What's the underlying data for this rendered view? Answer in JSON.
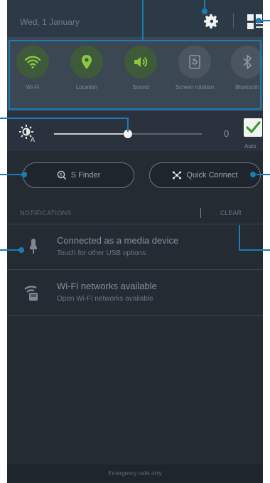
{
  "status": {
    "date": "Wed, 1 January"
  },
  "header_icons": [
    "gear-icon",
    "quick-panel-grid-icon"
  ],
  "quick_settings": [
    {
      "label": "Wi-Fi",
      "icon": "wifi-icon",
      "on": true
    },
    {
      "label": "Location",
      "icon": "location-icon",
      "on": true
    },
    {
      "label": "Sound",
      "icon": "sound-icon",
      "on": true
    },
    {
      "label": "Screen rotation",
      "icon": "rotation-icon",
      "on": false
    },
    {
      "label": "Bluetooth",
      "icon": "bluetooth-icon",
      "on": false
    }
  ],
  "brightness": {
    "value": "0",
    "auto_label": "Auto",
    "auto_checked": true,
    "level": 0.5
  },
  "buttons": {
    "s_finder": "S Finder",
    "quick_connect": "Quick Connect"
  },
  "notifications_header": {
    "label": "NOTIFICATIONS",
    "clear": "CLEAR"
  },
  "notifications": [
    {
      "title": "Connected as a media device",
      "subtitle": "Touch for other USB options"
    },
    {
      "title": "Wi-Fi networks available",
      "subtitle": "Open Wi-Fi networks available"
    }
  ],
  "footer": {
    "text": "Emergency calls only"
  },
  "colors": {
    "accent_green": "#8dc63f",
    "callout_blue": "#1b7db3",
    "panel_bg": "#252b33"
  }
}
